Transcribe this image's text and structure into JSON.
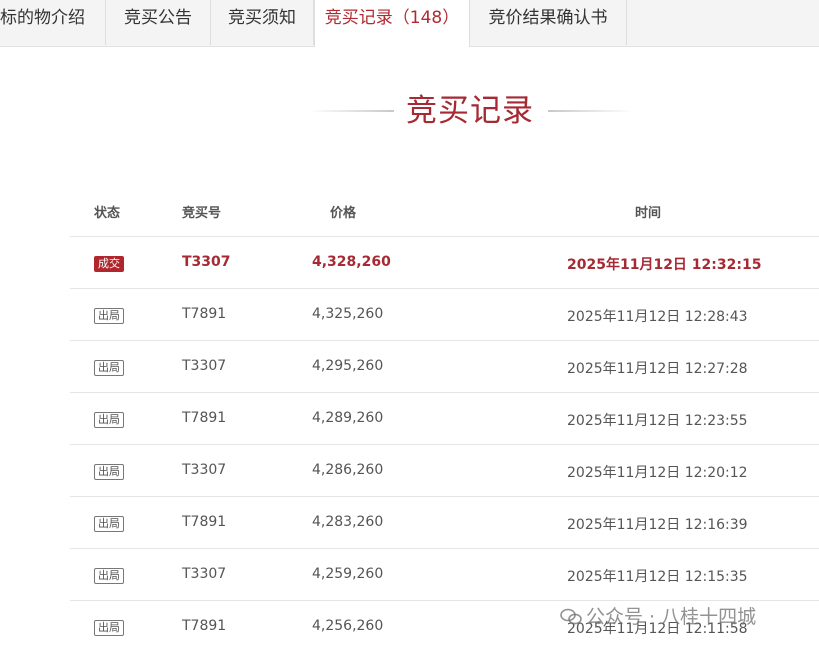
{
  "tabs": [
    {
      "label": "标的物介绍"
    },
    {
      "label": "竞买公告"
    },
    {
      "label": "竞买须知"
    },
    {
      "label": "竞买记录（148）"
    },
    {
      "label": "竞价结果确认书"
    }
  ],
  "active_tab": 3,
  "section_title": "竞买记录",
  "table": {
    "headers": {
      "status": "状态",
      "bid_no": "竞买号",
      "price": "价格",
      "time": "时间"
    },
    "rows": [
      {
        "status": "成交",
        "bid_no": "T3307",
        "price": "4,328,260",
        "time": "2025年11月12日 12:32:15"
      },
      {
        "status": "出局",
        "bid_no": "T7891",
        "price": "4,325,260",
        "time": "2025年11月12日 12:28:43"
      },
      {
        "status": "出局",
        "bid_no": "T3307",
        "price": "4,295,260",
        "time": "2025年11月12日 12:27:28"
      },
      {
        "status": "出局",
        "bid_no": "T7891",
        "price": "4,289,260",
        "time": "2025年11月12日 12:23:55"
      },
      {
        "status": "出局",
        "bid_no": "T3307",
        "price": "4,286,260",
        "time": "2025年11月12日 12:20:12"
      },
      {
        "status": "出局",
        "bid_no": "T7891",
        "price": "4,283,260",
        "time": "2025年11月12日 12:16:39"
      },
      {
        "status": "出局",
        "bid_no": "T3307",
        "price": "4,259,260",
        "time": "2025年11月12日 12:15:35"
      },
      {
        "status": "出局",
        "bid_no": "T7891",
        "price": "4,256,260",
        "time": "2025年11月12日 12:11:58"
      }
    ]
  },
  "watermark": "公众号 · 八桂十四城",
  "colors": {
    "accent": "#a52a33",
    "won_badge": "#b0262c",
    "tab_bar": "#f4f4f4"
  }
}
